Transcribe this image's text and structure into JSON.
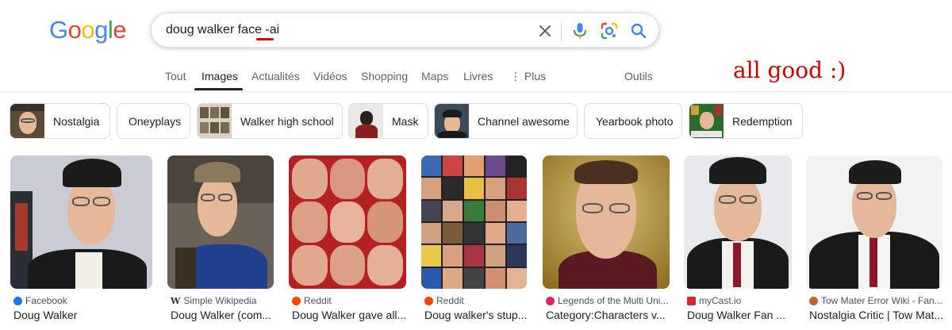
{
  "logo": {
    "letters": [
      {
        "ch": "G",
        "color": "#4285f4"
      },
      {
        "ch": "o",
        "color": "#ea4335"
      },
      {
        "ch": "o",
        "color": "#fbbc05"
      },
      {
        "ch": "g",
        "color": "#4285f4"
      },
      {
        "ch": "l",
        "color": "#34a853"
      },
      {
        "ch": "e",
        "color": "#ea4335"
      }
    ]
  },
  "search": {
    "query": "doug walker face -ai",
    "icons": [
      "clear-icon",
      "voice-search-icon",
      "lens-icon",
      "search-icon"
    ]
  },
  "annotation": "all good :)",
  "tabs": {
    "items": [
      {
        "label": "Tout",
        "active": false
      },
      {
        "label": "Images",
        "active": true
      },
      {
        "label": "Actualités",
        "active": false
      },
      {
        "label": "Vidéos",
        "active": false
      },
      {
        "label": "Shopping",
        "active": false
      },
      {
        "label": "Maps",
        "active": false
      },
      {
        "label": "Livres",
        "active": false
      },
      {
        "label": "⋮ Plus",
        "active": false
      }
    ],
    "tools": "Outils"
  },
  "chips": [
    {
      "label": "Nostalgia"
    },
    {
      "label": "Oneyplays"
    },
    {
      "label": "Walker high school"
    },
    {
      "label": "Mask"
    },
    {
      "label": "Channel awesome"
    },
    {
      "label": "Yearbook photo"
    },
    {
      "label": "Redemption"
    }
  ],
  "results": [
    {
      "source": "Facebook",
      "title": "Doug Walker",
      "favicon_color": "#1877f2"
    },
    {
      "source": "Simple Wikipedia",
      "title": "Doug Walker (com...",
      "favicon_color": "#333333"
    },
    {
      "source": "Reddit",
      "title": "Doug Walker gave all...",
      "favicon_color": "#ff4500"
    },
    {
      "source": "Reddit",
      "title": "Doug walker's stup...",
      "favicon_color": "#ff4500"
    },
    {
      "source": "Legends of the Multi Uni...",
      "title": "Category:Characters v...",
      "favicon_color": "#e0245e"
    },
    {
      "source": "myCast.io",
      "title": "Doug Walker Fan ...",
      "favicon_color": "#d8262f"
    },
    {
      "source": "Tow Mater Error Wiki - Fan...",
      "title": "Nostalgia Critic | Tow Mat...",
      "favicon_color": "#c0622d"
    }
  ],
  "colors": {
    "annotation": "#d40000",
    "tab_active": "#202124",
    "tab_inactive": "#5f6368"
  }
}
